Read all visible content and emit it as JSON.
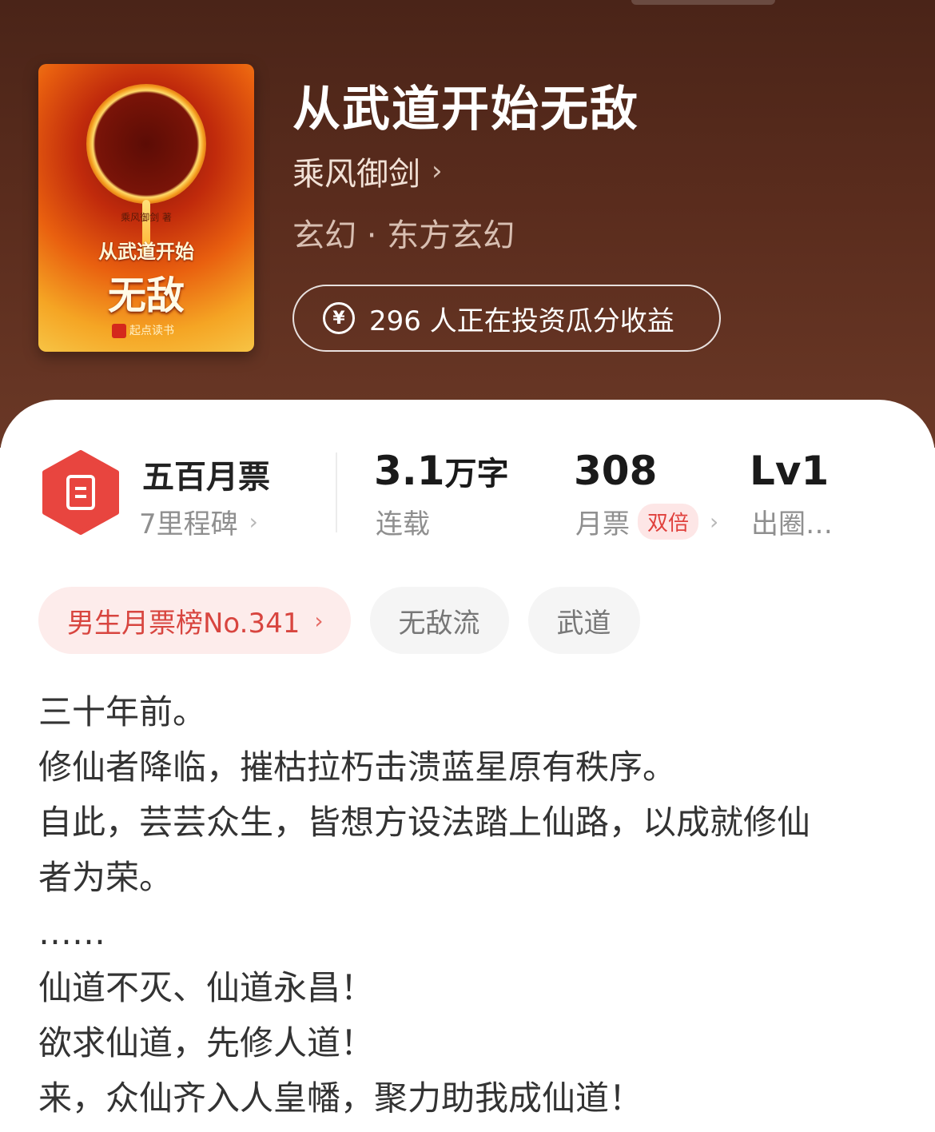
{
  "book": {
    "cover": {
      "author_line": "乘风御剑 著",
      "title_line1": "从武道开始",
      "title_line2": "无敌",
      "publisher": "起点读书"
    },
    "title": "从武道开始无敌",
    "author": "乘风御剑",
    "genre": "玄幻 · 东方玄幻",
    "invest_text": "296 人正在投资瓜分收益"
  },
  "stats": {
    "monthly": {
      "name": "五百月票",
      "milestone": "7里程碑"
    },
    "words": {
      "value": "3.1",
      "unit": "万字",
      "label": "连载"
    },
    "votes": {
      "value": "308",
      "label": "月票",
      "tag": "双倍"
    },
    "level": {
      "value": "Lv1",
      "label": "出圈…"
    }
  },
  "tags": {
    "rank": "男生月票榜No.341",
    "items": [
      "无敌流",
      "武道"
    ]
  },
  "intro": [
    "三十年前。",
    "修仙者降临，摧枯拉朽击溃蓝星原有秩序。",
    "自此，芸芸众生，皆想方设法踏上仙路，以成就修仙",
    "者为荣。",
    "……",
    "仙道不灭、仙道永昌！",
    "欲求仙道，先修人道！",
    "来，众仙齐入人皇幡，聚力助我成仙道！"
  ],
  "colors": {
    "header_bg": "#5a2c1d",
    "accent_red": "#e0403c",
    "badge_red": "#e8453f"
  },
  "icons": {
    "yen": "¥",
    "chevron": "›"
  }
}
